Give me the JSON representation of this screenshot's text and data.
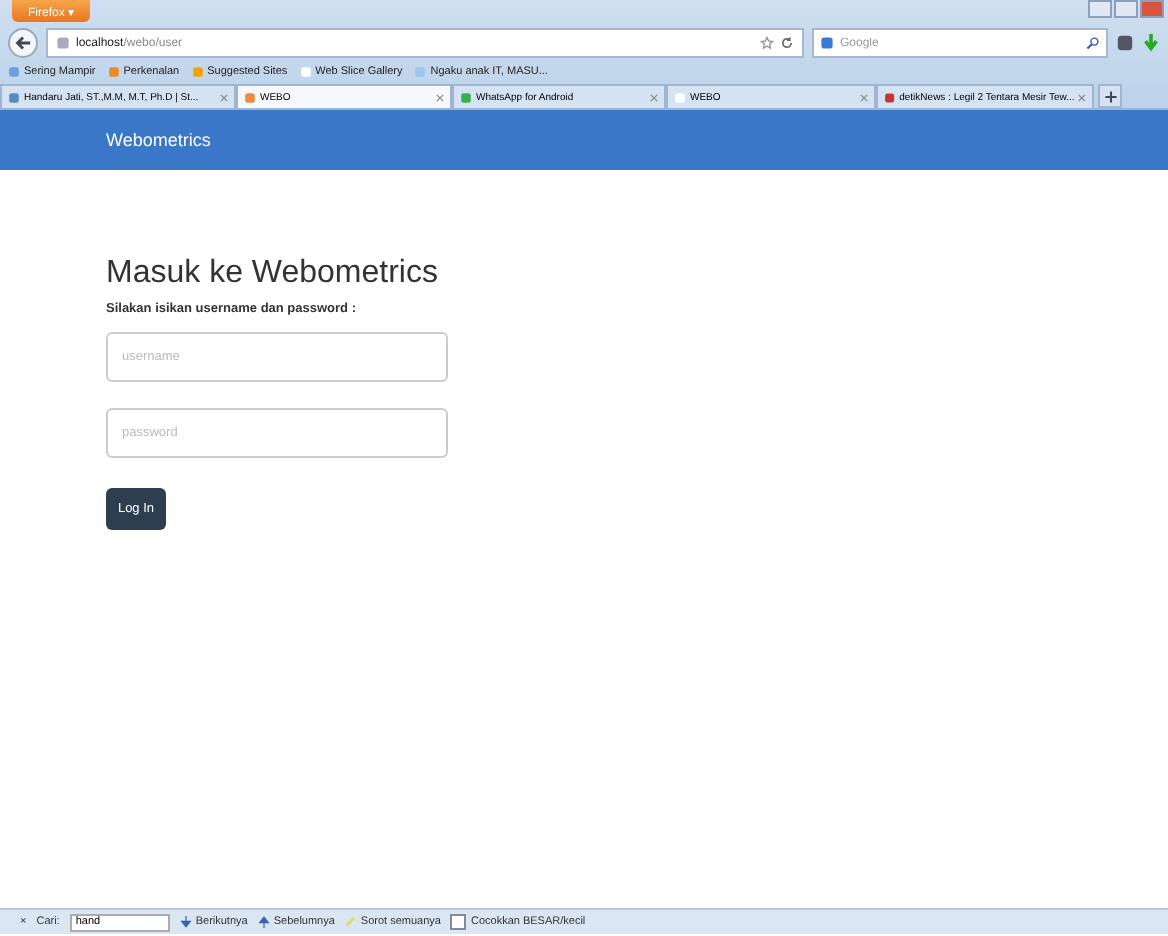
{
  "browser": {
    "menu_button": "Firefox ▾",
    "address": {
      "host": "localhost",
      "path": "/webo/user"
    },
    "search": {
      "placeholder": "Google"
    }
  },
  "bookmarks": [
    "Sering Mampir",
    "Perkenalan",
    "Suggested Sites",
    "Web Slice Gallery",
    "Ngaku anak IT, MASU..."
  ],
  "tabs": [
    {
      "label": "Handaru Jati, ST.,M.M, M.T, Ph.D | St...",
      "selected": false
    },
    {
      "label": "WEBO",
      "selected": true
    },
    {
      "label": "WhatsApp for Android",
      "selected": false
    },
    {
      "label": "WEBO",
      "selected": false
    },
    {
      "label": "detikNews : Legil 2 Tentara Mesir Tew...",
      "selected": false
    }
  ],
  "page": {
    "brand": "Webometrics",
    "heading": "Masuk ke Webometrics",
    "subheading": "Silakan isikan username dan password :",
    "fields": [
      {
        "placeholder": "username"
      },
      {
        "placeholder": "password"
      }
    ],
    "button": "Log In"
  },
  "find_bar": {
    "close": "×",
    "label": "Cari:",
    "value": "hand",
    "next": "Berikutnya",
    "previous": "Sebelumnya",
    "highlight": "Sorot semuanya",
    "match_case": {
      "label": "Cocokkan BESAR/kecil",
      "checked": false
    }
  }
}
